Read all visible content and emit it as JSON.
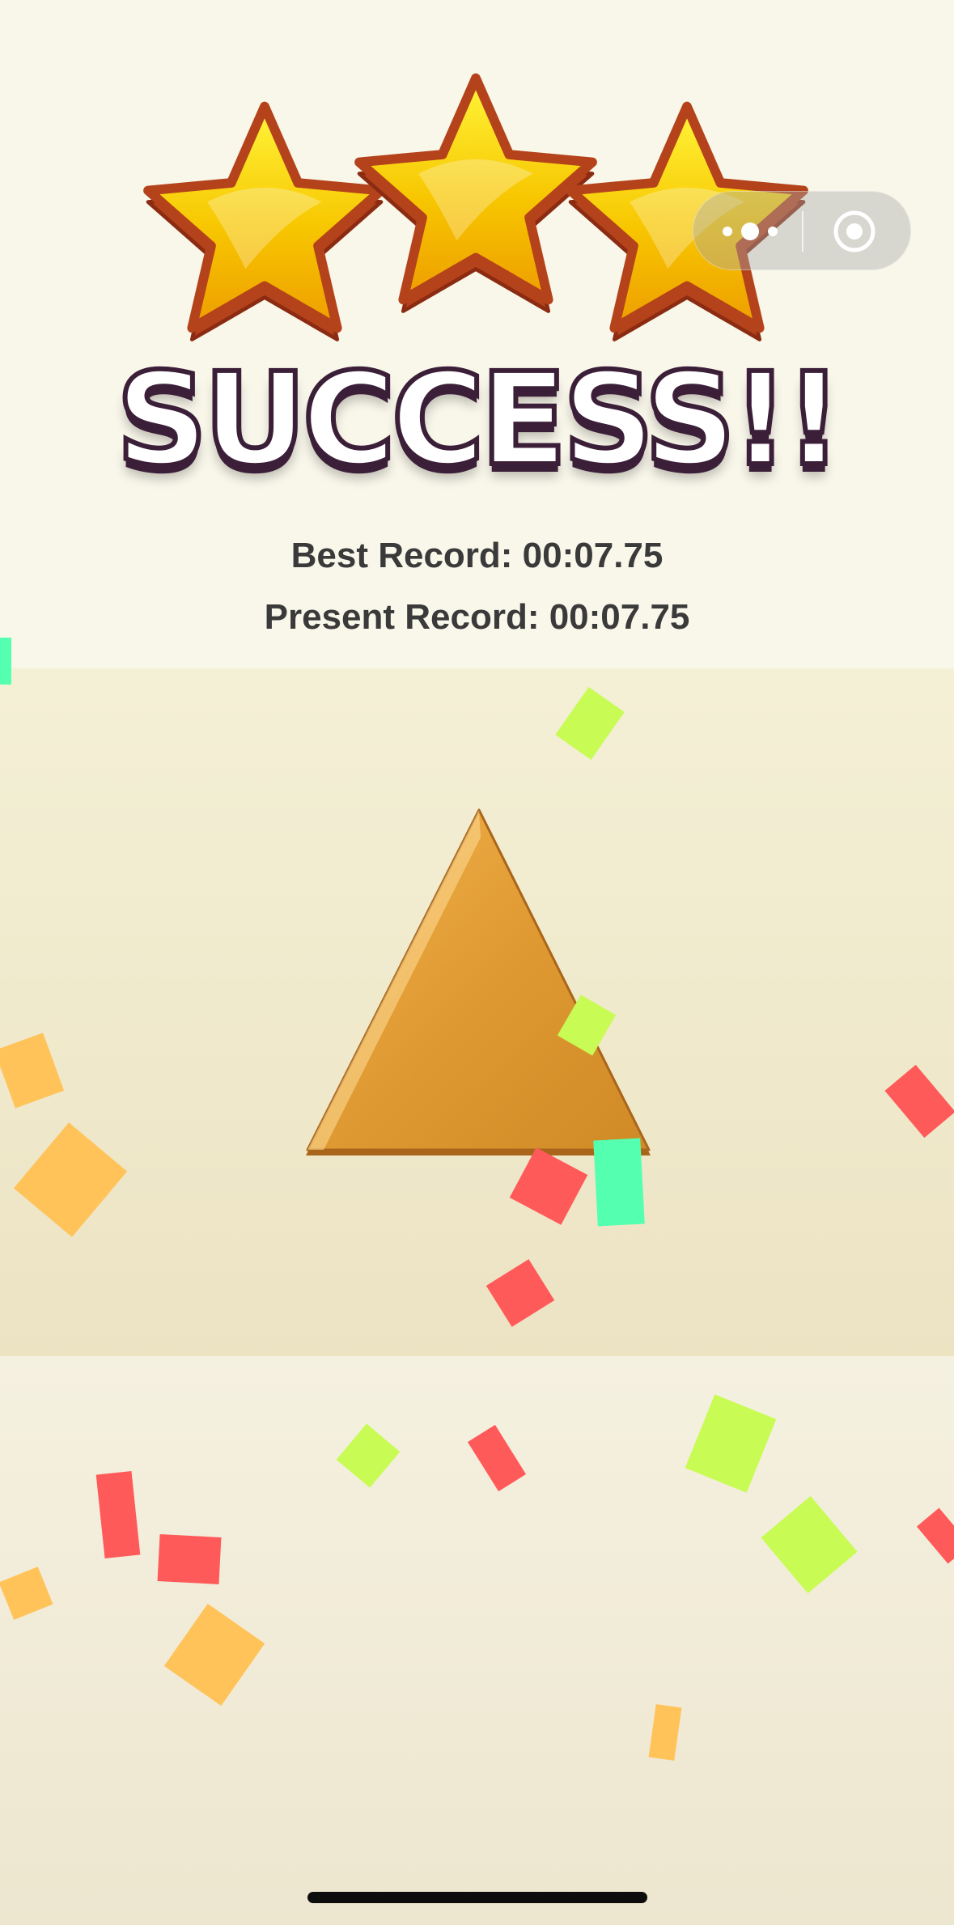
{
  "result": {
    "title": "SUCCESS!!",
    "stars_earned": 3,
    "stars_total": 3,
    "best_record_text": "Best Record: 00:07.75",
    "present_record_text": "Present Record: 00:07.75"
  },
  "mini_program_capsule": {
    "more_icon": "more-dots-icon",
    "close_icon": "target-close-icon"
  },
  "puzzle": {
    "shape": "triangle",
    "color": "#e09a33"
  },
  "colors": {
    "star_fill": "#f7c600",
    "star_outline": "#b4431b",
    "confetti_red": "#ff5a5a",
    "confetti_lime": "#c9fb55",
    "confetti_orange": "#ffc35a",
    "confetti_mint": "#55ffb0"
  }
}
